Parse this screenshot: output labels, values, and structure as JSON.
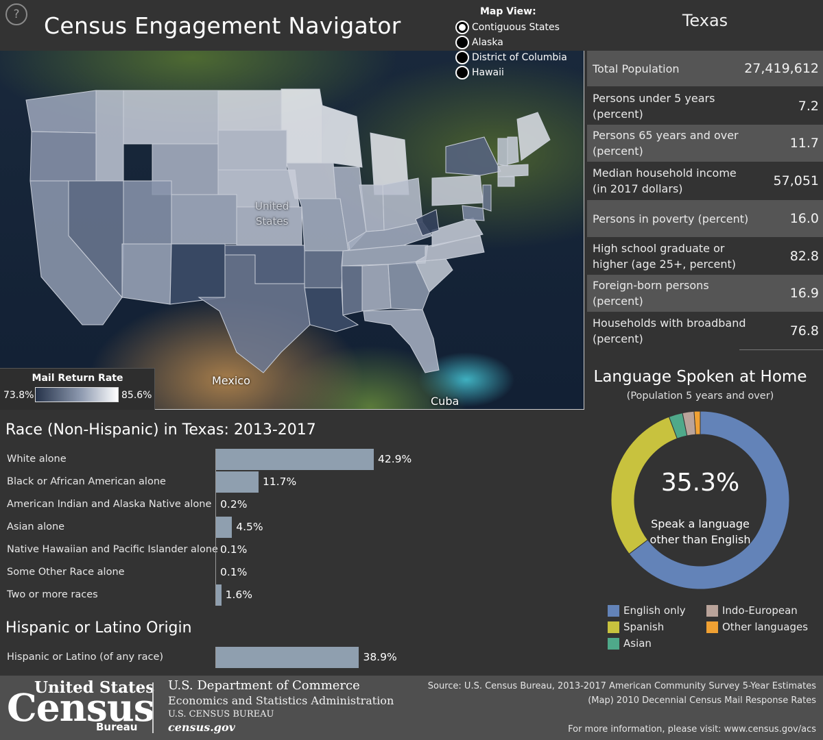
{
  "header": {
    "help_icon": "?",
    "title": "Census Engagement Navigator",
    "selected_state": "Texas"
  },
  "map_view": {
    "title": "Map View:",
    "options": [
      {
        "label": "Contiguous States",
        "selected": true
      },
      {
        "label": "Alaska",
        "selected": false
      },
      {
        "label": "District of Columbia",
        "selected": false
      },
      {
        "label": "Hawaii",
        "selected": false
      }
    ]
  },
  "map": {
    "labels": {
      "country": "United States",
      "country_line1": "United",
      "country_line2": "States",
      "mexico": "Mexico",
      "cuba": "Cuba"
    },
    "legend": {
      "title": "Mail Return Rate",
      "min": "73.8%",
      "max": "85.6%",
      "color_low": "#26334a",
      "color_high": "#ffffff"
    }
  },
  "stats": [
    {
      "label": "Total Population",
      "value": "27,419,612"
    },
    {
      "label": "Persons under 5 years (percent)",
      "value": "7.2"
    },
    {
      "label": "Persons 65 years and over (percent)",
      "value": "11.7"
    },
    {
      "label": "Median household income (in 2017 dollars)",
      "value": "57,051"
    },
    {
      "label": "Persons in poverty (percent)",
      "value": "16.0"
    },
    {
      "label": "High school graduate or higher (age 25+, percent)",
      "value": "82.8"
    },
    {
      "label": "Foreign-born persons (percent)",
      "value": "16.9"
    },
    {
      "label": "Households with broadband (percent)",
      "value": "76.8"
    }
  ],
  "race": {
    "title": "Race (Non-Hispanic) in Texas: 2013-2017",
    "bar_color": "#8f9faf",
    "items": [
      {
        "label": "White alone",
        "value": 42.9,
        "display": "42.9%"
      },
      {
        "label": "Black or African American alone",
        "value": 11.7,
        "display": "11.7%"
      },
      {
        "label": "American Indian and Alaska Native alone",
        "value": 0.2,
        "display": "0.2%"
      },
      {
        "label": "Asian alone",
        "value": 4.5,
        "display": "4.5%"
      },
      {
        "label": "Native Hawaiian and Pacific Islander alone",
        "value": 0.1,
        "display": "0.1%"
      },
      {
        "label": "Some Other Race alone",
        "value": 0.1,
        "display": "0.1%"
      },
      {
        "label": "Two or more races",
        "value": 1.6,
        "display": "1.6%"
      }
    ]
  },
  "hispanic": {
    "title": "Hispanic or Latino Origin",
    "items": [
      {
        "label": "Hispanic or Latino (of any race)",
        "value": 38.9,
        "display": "38.9%"
      }
    ]
  },
  "language": {
    "title": "Language Spoken at Home",
    "subtitle": "(Population 5 years and over)",
    "center_value": "35.3%",
    "center_caption_line1": "Speak a language",
    "center_caption_line2": "other than English",
    "segments": [
      {
        "name": "English only",
        "value": 64.7,
        "color": "#6383b8"
      },
      {
        "name": "Spanish",
        "value": 29.6,
        "color": "#c8c23e"
      },
      {
        "name": "Asian",
        "value": 2.5,
        "color": "#4fa98a"
      },
      {
        "name": "Indo-European",
        "value": 2.1,
        "color": "#b9a39a"
      },
      {
        "name": "Other languages",
        "value": 1.1,
        "color": "#f0a133"
      }
    ]
  },
  "footer": {
    "logo_line1": "United States",
    "logo_line2": "Census",
    "logo_line3": "Bureau",
    "dept_line1": "U.S. Department of Commerce",
    "dept_line2": "Economics and Statistics Administration",
    "dept_line3": "U.S. CENSUS BUREAU",
    "dept_line4": "census.gov",
    "source_line1": "Source: U.S. Census Bureau, 2013-2017 American Community Survey 5-Year Estimates",
    "source_line2": "(Map) 2010 Decennial Census Mail Response Rates",
    "source_line3": "For more information, please visit: www.census.gov/acs"
  }
}
